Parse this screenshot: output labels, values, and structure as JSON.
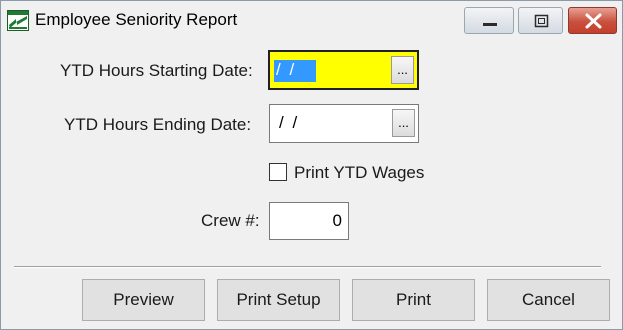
{
  "window": {
    "title": "Employee Seniority Report",
    "icon": "green-report-app-icon",
    "controls": {
      "minimize_icon": "minimize-icon",
      "maximize_icon": "maximize-icon",
      "close_icon": "close-icon"
    }
  },
  "form": {
    "start_date": {
      "label": "YTD Hours Starting Date:",
      "value": "/ /",
      "picker_label": "...",
      "background": "#ffff00"
    },
    "end_date": {
      "label": "YTD Hours Ending Date:",
      "value": "/ /",
      "picker_label": "..."
    },
    "print_wages": {
      "label": "Print YTD Wages",
      "checked": false
    },
    "crew": {
      "label": "Crew #:",
      "value": "0"
    }
  },
  "buttons": {
    "preview": "Preview",
    "print_setup": "Print Setup",
    "print": "Print",
    "cancel": "Cancel"
  },
  "colors": {
    "selection": "#3399ff",
    "close_button": "#c9503e",
    "window_bg": "#f0f0f0"
  }
}
